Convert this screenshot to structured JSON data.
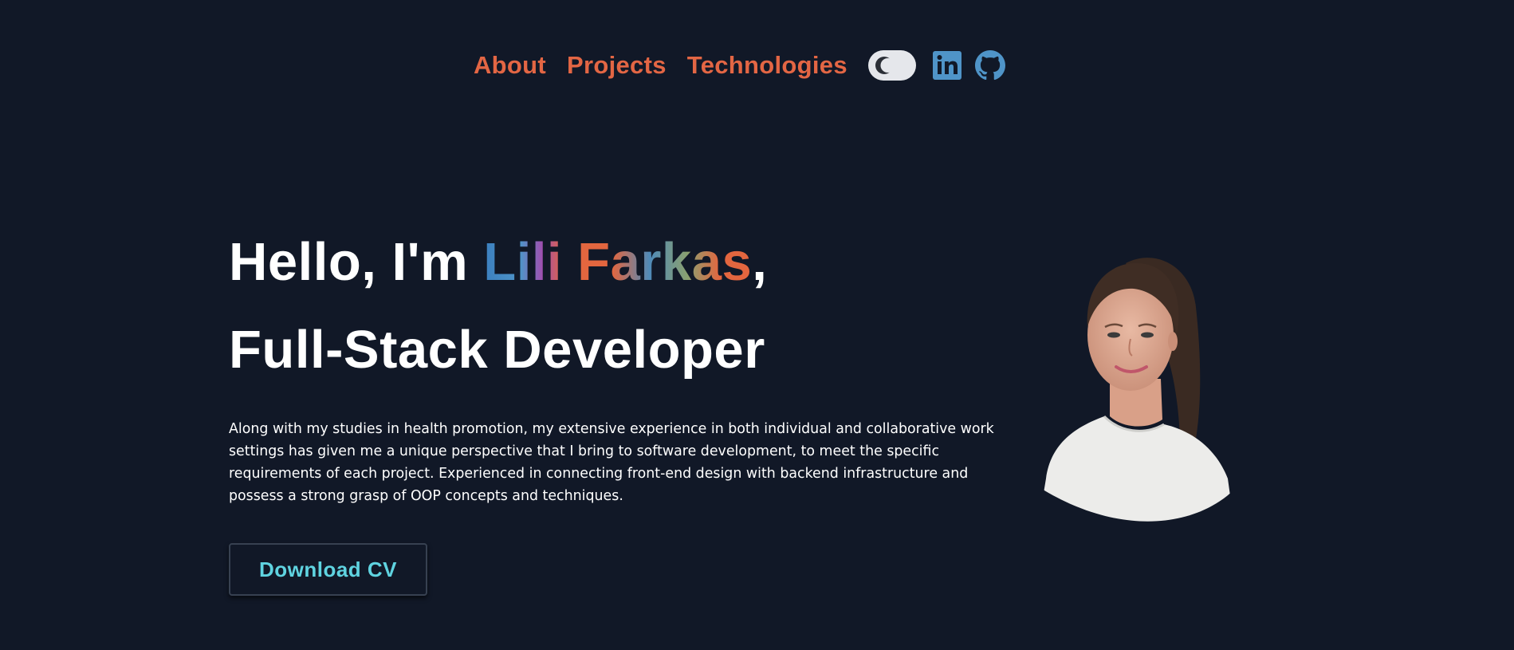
{
  "nav": {
    "links": [
      {
        "label": "About"
      },
      {
        "label": "Projects"
      },
      {
        "label": "Technologies"
      }
    ],
    "theme_toggle": {
      "icon": "moon-icon",
      "state": "dark"
    },
    "social": [
      {
        "icon": "linkedin-icon"
      },
      {
        "icon": "github-icon"
      }
    ]
  },
  "hero": {
    "greeting": "Hello, I'm ",
    "name": "Lili Farkas",
    "name_suffix": ",",
    "role": "Full-Stack Developer",
    "bio": "Along with my studies in health promotion, my extensive experience in both individual and collaborative work settings has given me a unique perspective that I bring to software development, to meet the specific requirements of each project. Experienced in connecting front-end design with backend infrastructure and possess a strong grasp of OOP concepts and techniques.",
    "cta_label": "Download CV"
  },
  "colors": {
    "background": "#111827",
    "nav_link": "#e36644",
    "accent_blue": "#4f94c8",
    "cta_text": "#5fd3e0",
    "heading": "#ffffff"
  }
}
